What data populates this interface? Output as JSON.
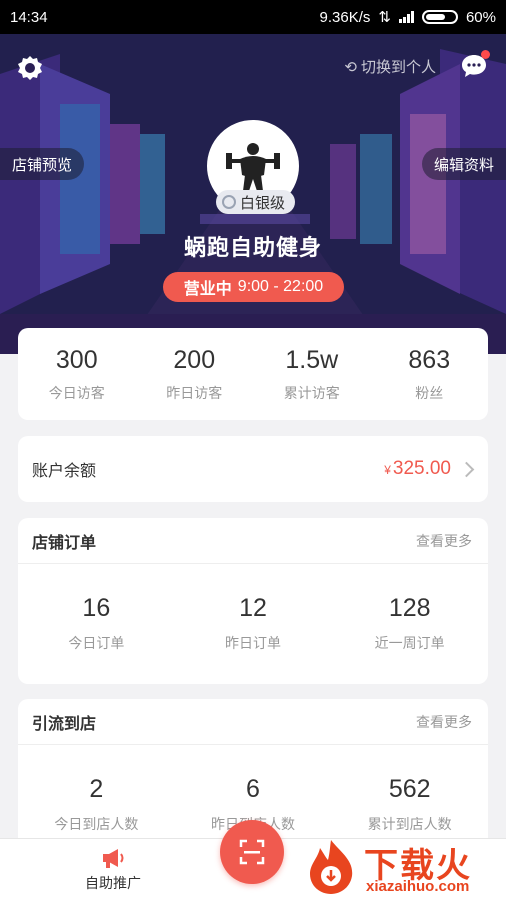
{
  "status_bar": {
    "time": "14:34",
    "network_speed": "9.36K/s",
    "battery": "60%"
  },
  "header": {
    "switch_label": "切换到个人",
    "preview_label": "店铺预览",
    "edit_label": "编辑资料",
    "store_name": "蜗跑自助健身",
    "level": "白银级",
    "hours_status": "营业中",
    "hours": "9:00 - 22:00"
  },
  "stats": [
    {
      "value": "300",
      "label": "今日访客"
    },
    {
      "value": "200",
      "label": "昨日访客"
    },
    {
      "value": "1.5w",
      "label": "累计访客"
    },
    {
      "value": "863",
      "label": "粉丝"
    }
  ],
  "balance": {
    "label": "账户余额",
    "currency": "¥",
    "amount": "325.00"
  },
  "orders": {
    "title": "店铺订单",
    "more": "查看更多",
    "items": [
      {
        "value": "16",
        "label": "今日订单"
      },
      {
        "value": "12",
        "label": "昨日订单"
      },
      {
        "value": "128",
        "label": "近一周订单"
      }
    ]
  },
  "traffic": {
    "title": "引流到店",
    "more": "查看更多",
    "items": [
      {
        "value": "2",
        "label": "今日到店人数"
      },
      {
        "value": "6",
        "label": "昨日到店人数"
      },
      {
        "value": "562",
        "label": "累计到店人数"
      }
    ]
  },
  "bottom_nav": {
    "promo_label": "自助推广"
  },
  "watermark": {
    "text": "下载火",
    "url": "xiazaihuo.com"
  },
  "colors": {
    "accent": "#f05a4f",
    "hero_bg": "#2a1a5c",
    "watermark": "#e8451f"
  }
}
